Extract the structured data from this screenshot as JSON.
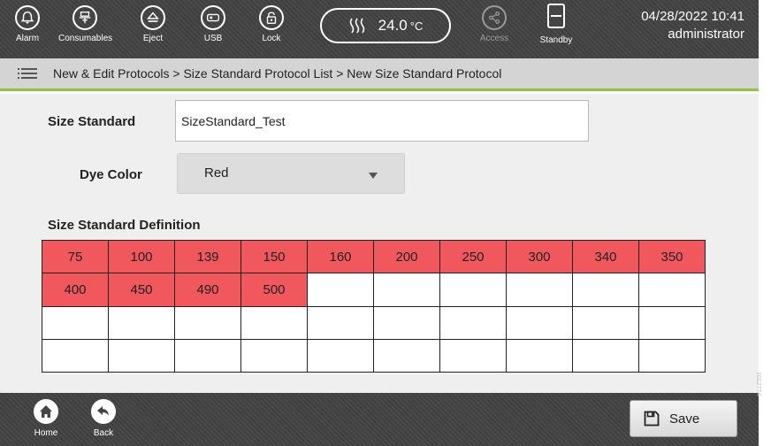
{
  "topbar": {
    "buttons": [
      {
        "label": "Alarm",
        "icon": "bell-icon"
      },
      {
        "label": "Consumables",
        "icon": "consumables-icon"
      },
      {
        "label": "Eject",
        "icon": "eject-icon"
      },
      {
        "label": "USB",
        "icon": "usb-icon"
      },
      {
        "label": "Lock",
        "icon": "lock-icon"
      }
    ],
    "temperature": {
      "value": "24.0",
      "unit": "°C"
    },
    "access": {
      "label": "Access",
      "icon": "share-icon"
    },
    "standby": {
      "label": "Standby",
      "icon": "standby-icon"
    },
    "datetime": "04/28/2022 10:41",
    "user": "administrator"
  },
  "breadcrumb": "New & Edit Protocols > Size Standard Protocol List > New Size Standard Protocol",
  "form": {
    "size_standard_label": "Size Standard",
    "size_standard_value": "SizeStandard_Test",
    "dye_color_label": "Dye Color",
    "dye_color_value": "Red",
    "definition_label": "Size Standard Definition",
    "grid": [
      [
        "75",
        "100",
        "139",
        "150",
        "160",
        "200",
        "250",
        "300",
        "340",
        "350"
      ],
      [
        "400",
        "450",
        "490",
        "500",
        "",
        "",
        "",
        "",
        "",
        ""
      ],
      [
        "",
        "",
        "",
        "",
        "",
        "",
        "",
        "",
        "",
        ""
      ],
      [
        "",
        "",
        "",
        "",
        "",
        "",
        "",
        "",
        "",
        ""
      ]
    ]
  },
  "bottombar": {
    "home_label": "Home",
    "back_label": "Back",
    "save_label": "Save"
  },
  "side_code": "1012774",
  "colors": {
    "accent_green": "#8cc63f",
    "filled_cell": "#f1585d",
    "bar_dark": "#454545"
  }
}
